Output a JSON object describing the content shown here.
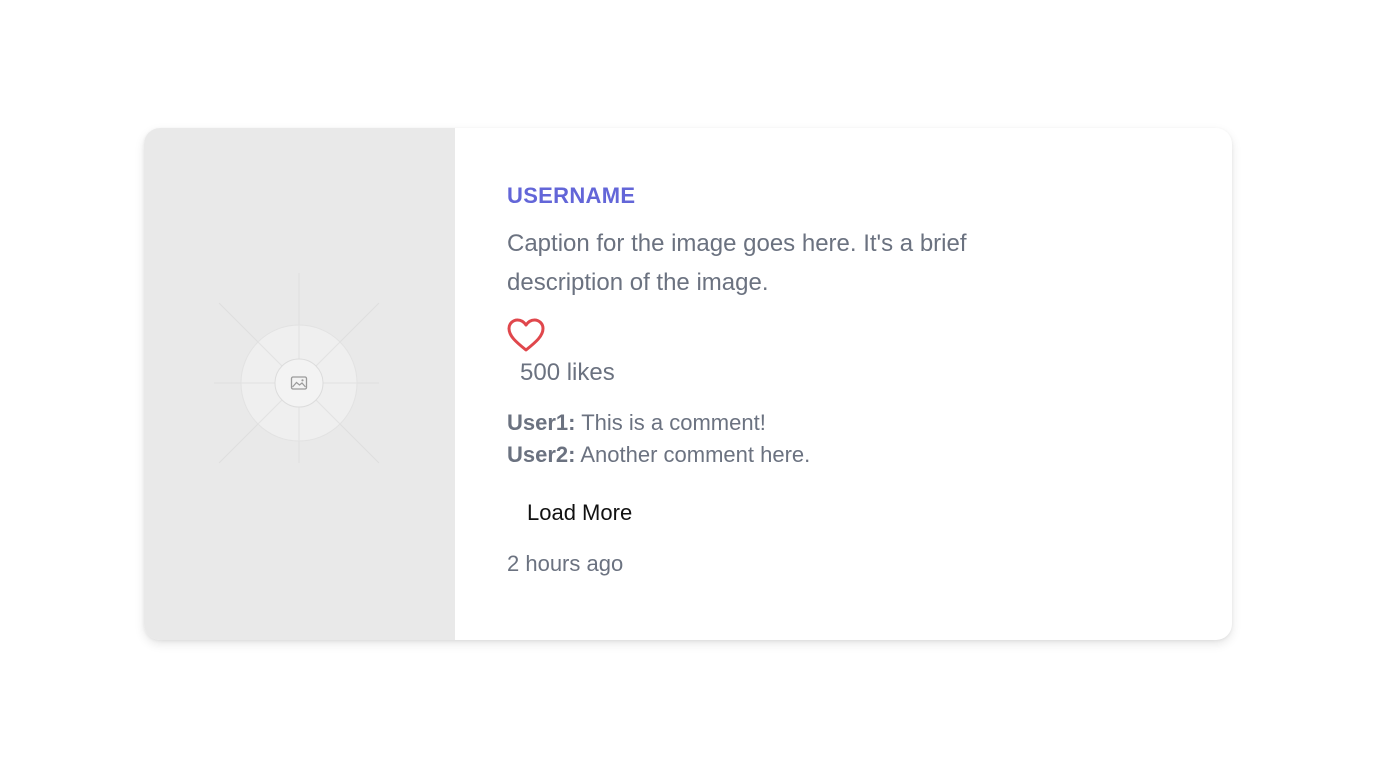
{
  "post": {
    "username": "USERNAME",
    "caption": "Caption for the image goes here. It's a brief description of the image.",
    "likes_text": "500 likes",
    "comments": [
      {
        "user": "User1:",
        "text": " This is a comment!"
      },
      {
        "user": "User2:",
        "text": " Another comment here."
      }
    ],
    "load_more_label": "Load More",
    "timestamp": "2 hours ago"
  },
  "icons": {
    "image_placeholder": "image-icon",
    "like": "heart-icon"
  },
  "colors": {
    "username": "#6366d8",
    "heart": "#e0474c",
    "muted_text": "#6b7280",
    "image_bg": "#e9e9e9"
  }
}
